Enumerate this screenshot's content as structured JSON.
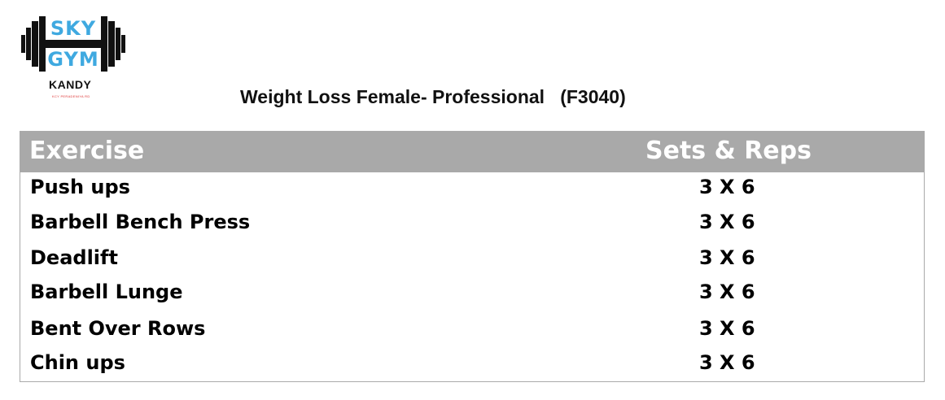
{
  "logo": {
    "line1": "SKY",
    "line2": "GYM",
    "location": "KANDY",
    "tagline": "KCY PERADENIYA RD",
    "colors": {
      "text": "#3fa9e0",
      "weights": "#111111"
    }
  },
  "title": "Weight Loss Female- Professional   (F3040)",
  "table": {
    "header_color": "#a9a9a9",
    "headers": {
      "exercise": "Exercise",
      "sets_reps": "Sets & Reps"
    },
    "rows": [
      {
        "exercise": "Push ups",
        "sets_reps": "3 X 6"
      },
      {
        "exercise": "Barbell Bench Press",
        "sets_reps": "3 X 6"
      },
      {
        "exercise": "Deadlift",
        "sets_reps": "3 X 6"
      },
      {
        "exercise": "Barbell Lunge",
        "sets_reps": "3 X 6"
      },
      {
        "exercise": "Bent Over Rows",
        "sets_reps": "3 X 6"
      },
      {
        "exercise": "Chin ups",
        "sets_reps": "3 X 6"
      }
    ]
  }
}
